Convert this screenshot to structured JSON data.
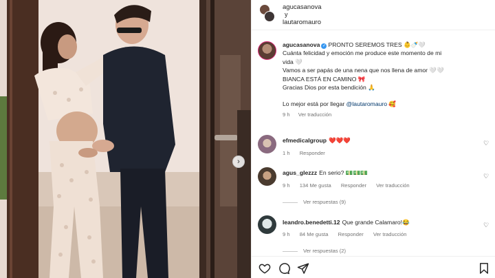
{
  "header": {
    "user1": "agucasanova",
    "connector": "y",
    "user2": "lautaromauro"
  },
  "caption": {
    "username": "agucasanova",
    "first_line": "PRONTO SEREMOS TRES 👶🍼🤍",
    "lines": [
      "Cuánta felicidad y emoción me produce este momento de mi",
      "vida 🤍",
      "Vamos a ser papás de una nena que nos llena de amor 🤍🤍",
      "BIANCA ESTÁ EN CAMINO 🎀",
      "Gracias Dios por esta bendición 🙏"
    ],
    "closing_text": "Lo mejor está por llegar",
    "closing_mention": "@lautaromauro",
    "closing_emoji": "🥰",
    "time": "9 h",
    "translate": "Ver traducción"
  },
  "comments": [
    {
      "username": "efmedicalgroup",
      "text": "❤️❤️❤️",
      "time": "1 h",
      "likes": "",
      "reply": "Responder",
      "translate": "",
      "view_replies": ""
    },
    {
      "username": "agus_glezzz",
      "text": "En serio? 💵💵💵",
      "time": "9 h",
      "likes": "134 Me gusta",
      "reply": "Responder",
      "translate": "Ver traducción",
      "view_replies": "Ver respuestas (9)"
    },
    {
      "username": "leandro.benedetti.12",
      "text": "Que grande Calamaro!😂",
      "time": "9 h",
      "likes": "84 Me gusta",
      "reply": "Responder",
      "translate": "Ver traducción",
      "view_replies": "Ver respuestas (2)"
    }
  ],
  "icons": {
    "carousel_next": "chevron-right-icon",
    "comment_like": "heart-outline-icon",
    "like": "heart-icon",
    "comment": "comment-icon",
    "share": "send-icon",
    "save": "bookmark-icon"
  },
  "colors": {
    "verified": "#3897f0",
    "mention": "#00376b",
    "meta_text": "#737373",
    "story_ring": "#d62976"
  }
}
